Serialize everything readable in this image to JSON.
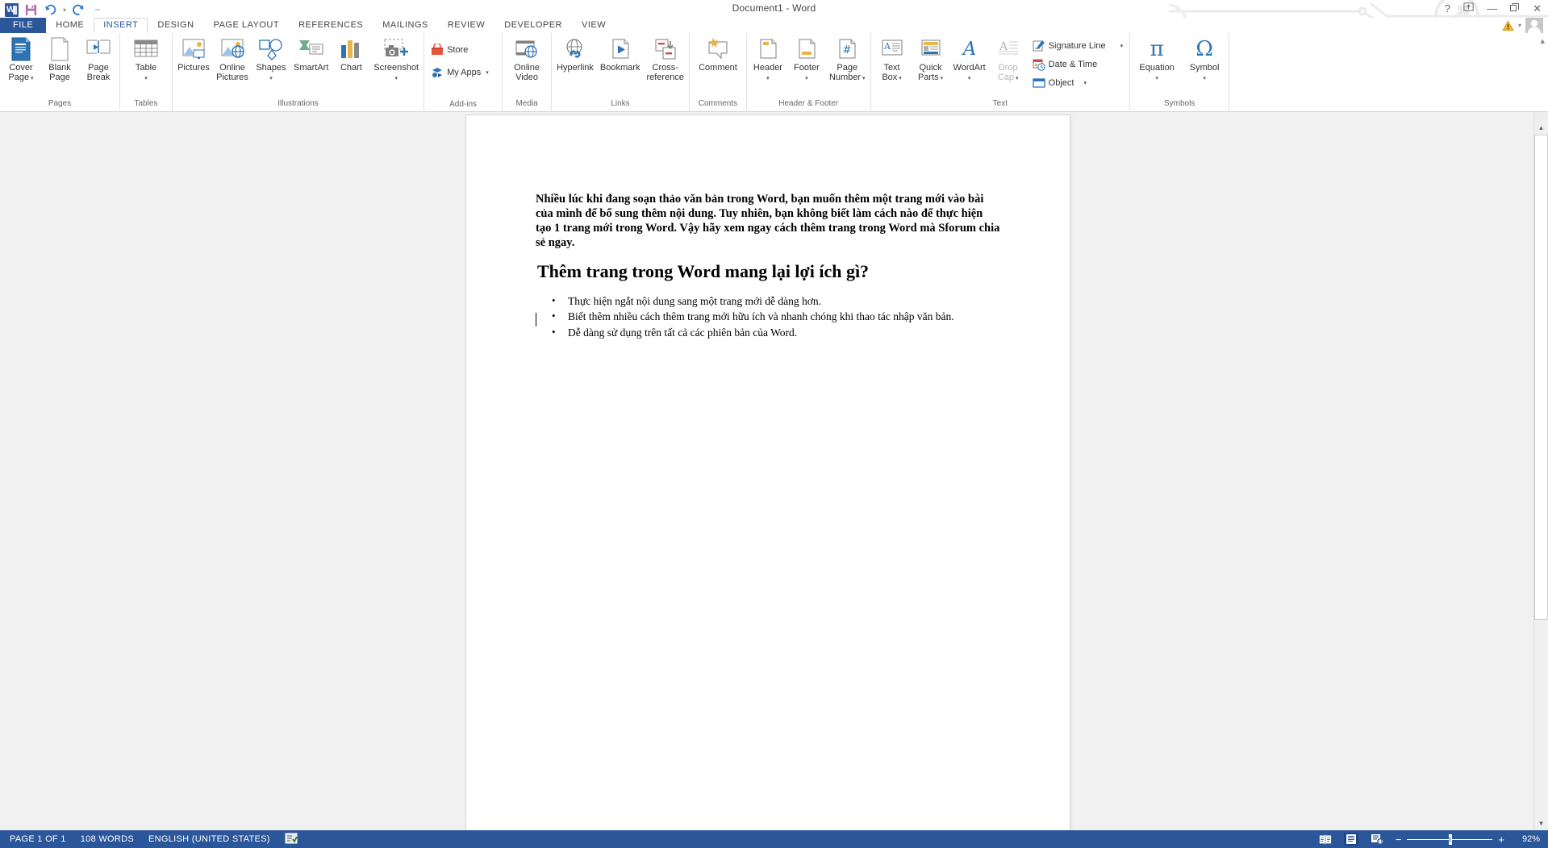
{
  "window": {
    "title": "Document1 - Word",
    "quick_access": [
      {
        "name": "word-logo-icon",
        "label": "W"
      },
      {
        "name": "save-icon",
        "label": "Save"
      },
      {
        "name": "undo-icon",
        "label": "Undo"
      },
      {
        "name": "redo-icon",
        "label": "Redo"
      },
      {
        "name": "customize-qat-icon",
        "label": "Customize Quick Access Toolbar"
      }
    ],
    "controls": [
      {
        "name": "help-button",
        "glyph": "?"
      },
      {
        "name": "ribbon-display-options-button",
        "glyph": "⤒"
      },
      {
        "name": "minimize-button",
        "glyph": "—"
      },
      {
        "name": "restore-button",
        "glyph": "❐"
      },
      {
        "name": "close-button",
        "glyph": "✕"
      }
    ]
  },
  "tabs": {
    "file_label": "FILE",
    "items": [
      {
        "label": "HOME",
        "active": false
      },
      {
        "label": "INSERT",
        "active": true
      },
      {
        "label": "DESIGN",
        "active": false
      },
      {
        "label": "PAGE LAYOUT",
        "active": false
      },
      {
        "label": "REFERENCES",
        "active": false
      },
      {
        "label": "MAILINGS",
        "active": false
      },
      {
        "label": "REVIEW",
        "active": false
      },
      {
        "label": "DEVELOPER",
        "active": false
      },
      {
        "label": "VIEW",
        "active": false
      }
    ],
    "account_warning": "warning-icon",
    "account_avatar": "user-avatar"
  },
  "ribbon": {
    "collapse_glyph": "▴",
    "groups": [
      {
        "name": "pages",
        "label": "Pages",
        "buttons": [
          {
            "label": "Cover\nPage",
            "icon": "cover-page-icon",
            "dropdown": true
          },
          {
            "label": "Blank\nPage",
            "icon": "blank-page-icon",
            "dropdown": false
          },
          {
            "label": "Page\nBreak",
            "icon": "page-break-icon",
            "dropdown": false
          }
        ]
      },
      {
        "name": "tables",
        "label": "Tables",
        "buttons": [
          {
            "label": "Table",
            "icon": "table-icon",
            "dropdown": true
          }
        ]
      },
      {
        "name": "illustrations",
        "label": "Illustrations",
        "buttons": [
          {
            "label": "Pictures",
            "icon": "pictures-icon",
            "dropdown": false
          },
          {
            "label": "Online\nPictures",
            "icon": "online-pictures-icon",
            "dropdown": false
          },
          {
            "label": "Shapes",
            "icon": "shapes-icon",
            "dropdown": true
          },
          {
            "label": "SmartArt",
            "icon": "smartart-icon",
            "dropdown": false
          },
          {
            "label": "Chart",
            "icon": "chart-icon",
            "dropdown": false
          },
          {
            "label": "Screenshot",
            "icon": "screenshot-icon",
            "dropdown": true
          }
        ]
      },
      {
        "name": "add-ins",
        "label": "Add-ins",
        "small_buttons": [
          {
            "label": "Store",
            "icon": "store-icon",
            "dropdown": false
          },
          {
            "label": "My Apps",
            "icon": "my-apps-icon",
            "dropdown": true
          }
        ]
      },
      {
        "name": "media",
        "label": "Media",
        "buttons": [
          {
            "label": "Online\nVideo",
            "icon": "online-video-icon",
            "dropdown": false
          }
        ]
      },
      {
        "name": "links",
        "label": "Links",
        "buttons": [
          {
            "label": "Hyperlink",
            "icon": "hyperlink-icon",
            "dropdown": false
          },
          {
            "label": "Bookmark",
            "icon": "bookmark-icon",
            "dropdown": false
          },
          {
            "label": "Cross-\nreference",
            "icon": "cross-reference-icon",
            "dropdown": false
          }
        ]
      },
      {
        "name": "comments",
        "label": "Comments",
        "buttons": [
          {
            "label": "Comment",
            "icon": "comment-icon",
            "dropdown": false
          }
        ]
      },
      {
        "name": "header-footer",
        "label": "Header & Footer",
        "buttons": [
          {
            "label": "Header",
            "icon": "header-icon",
            "dropdown": true
          },
          {
            "label": "Footer",
            "icon": "footer-icon",
            "dropdown": true
          },
          {
            "label": "Page\nNumber",
            "icon": "page-number-icon",
            "dropdown": true
          }
        ]
      },
      {
        "name": "text",
        "label": "Text",
        "buttons": [
          {
            "label": "Text\nBox",
            "icon": "text-box-icon",
            "dropdown": true
          },
          {
            "label": "Quick\nParts",
            "icon": "quick-parts-icon",
            "dropdown": true
          },
          {
            "label": "WordArt",
            "icon": "wordart-icon",
            "dropdown": true
          },
          {
            "label": "Drop\nCap",
            "icon": "drop-cap-icon",
            "dropdown": true,
            "disabled": true
          }
        ],
        "small_buttons": [
          {
            "label": "Signature Line",
            "icon": "signature-line-icon",
            "dropdown": true
          },
          {
            "label": "Date & Time",
            "icon": "date-time-icon",
            "dropdown": false
          },
          {
            "label": "Object",
            "icon": "object-icon",
            "dropdown": true
          }
        ]
      },
      {
        "name": "symbols",
        "label": "Symbols",
        "buttons": [
          {
            "label": "Equation",
            "icon": "equation-icon",
            "glyph": "π",
            "dropdown": true
          },
          {
            "label": "Symbol",
            "icon": "symbol-icon",
            "glyph": "Ω",
            "dropdown": true
          }
        ]
      }
    ]
  },
  "document": {
    "paragraph": "Nhiều lúc khi đang soạn thảo văn bản trong Word, bạn muốn thêm một trang mới vào bài của mình để bổ sung thêm nội dung. Tuy nhiên, bạn không biết làm cách nào để thực hiện tạo 1 trang mới trong Word. Vậy hãy xem ngay cách thêm trang trong Word mà Sforum chia sẻ ngay.",
    "heading": "Thêm trang trong Word mang lại lợi ích gì?",
    "bullets": [
      "Thực hiện ngắt nội dung sang một trang mới dễ dàng hơn.",
      "Biết thêm nhiều cách thêm trang mới hữu ích và nhanh chóng khi thao tác nhập văn bản.",
      "Dễ dàng sử dụng trên tất cả các phiên bản của Word."
    ]
  },
  "statusbar": {
    "page": "PAGE 1 OF 1",
    "words": "108 WORDS",
    "language": "ENGLISH (UNITED STATES)",
    "proofing_icon": "proofing-errors-icon",
    "views": [
      {
        "name": "read-mode-view-button",
        "selected": false
      },
      {
        "name": "print-layout-view-button",
        "selected": true
      },
      {
        "name": "web-layout-view-button",
        "selected": false
      }
    ],
    "zoom_out": "−",
    "zoom_in": "+",
    "zoom_level": "92%"
  },
  "colors": {
    "accent": "#2b579a",
    "ribbon_bg": "#ffffff",
    "workspace_bg": "#f1f1f1",
    "icon_blue": "#2e74b5",
    "icon_gold": "#e8b54d"
  }
}
